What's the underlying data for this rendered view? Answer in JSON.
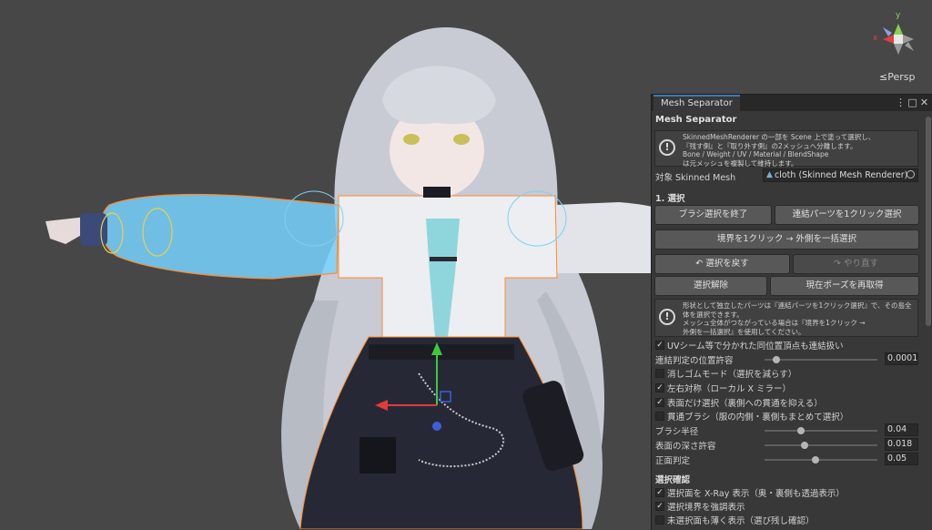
{
  "scene": {
    "persp_label": "≤Persp",
    "gizmo": {
      "y_label": "y",
      "x_label": "x"
    }
  },
  "panel": {
    "tab_label": "Mesh Separator",
    "title": "Mesh Separator",
    "help1": "SkinnedMeshRenderer の一部を Scene 上で塗って選択し、\n『残す側』と『取り外す側』の2メッシュへ分離します。\nBone / Weight / UV / Material / BlendShape\nは元メッシュを複製して維持します。",
    "target_label": "対象 Skinned Mesh",
    "target_value": "cloth (Skinned Mesh Renderer)",
    "section1": "1. 選択",
    "buttons": {
      "end_brush": "ブラシ選択を終了",
      "connected_one_click": "連結パーツを1クリック選択",
      "boundary_outer": "境界を1クリック → 外側を一括選択",
      "undo_select": "↶ 選択を戻す",
      "redo": "↷ やり直す",
      "deselect": "選択解除",
      "reacquire_pose": "現在ポーズを再取得"
    },
    "help2": "形状として独立したパーツは『連結パーツを1クリック選択』で、その島全体を選択できます。\nメッシュ全体がつながっている場合は『境界を1クリック →\n外側を一括選択』を使用してください。",
    "uv_seam_check": "UVシーム等で分かれた同位置頂点も連結扱い",
    "tolerance_label": "連結判定の位置許容",
    "tolerance_value": "0.0001",
    "tolerance_fraction": 0.0,
    "eraser_mode": "消しゴムモード（選択を減らす）",
    "mirror": "左右対称（ローカル X ミラー）",
    "surface_only": "表面だけ選択（裏側への貫通を抑える）",
    "through_brush": "貫通ブラシ（服の内側・裏側もまとめて選択）",
    "brush_radius_label": "ブラシ半径",
    "brush_radius_value": "0.04",
    "brush_radius_fraction": 0.33,
    "depth_tol_label": "表面の深さ許容",
    "depth_tol_value": "0.018",
    "depth_tol_fraction": 0.36,
    "front_label": "正面判定",
    "front_value": "0.05",
    "front_fraction": 0.45,
    "section2": "選択確認",
    "xray": "選択面を X-Ray 表示（奥・裏側も透過表示）",
    "highlight_border": "選択境界を強調表示",
    "faint_unselected": "未選択面も薄く表示（選び残し確認）"
  },
  "checks": {
    "uv_seam": true,
    "eraser": false,
    "mirror": true,
    "surface_only": true,
    "through": false,
    "xray": true,
    "highlight": true,
    "faint": false
  },
  "colors": {
    "background": "#474747",
    "panel": "#383838",
    "accent": "#3a79bb",
    "selection": "#73d2ff"
  }
}
